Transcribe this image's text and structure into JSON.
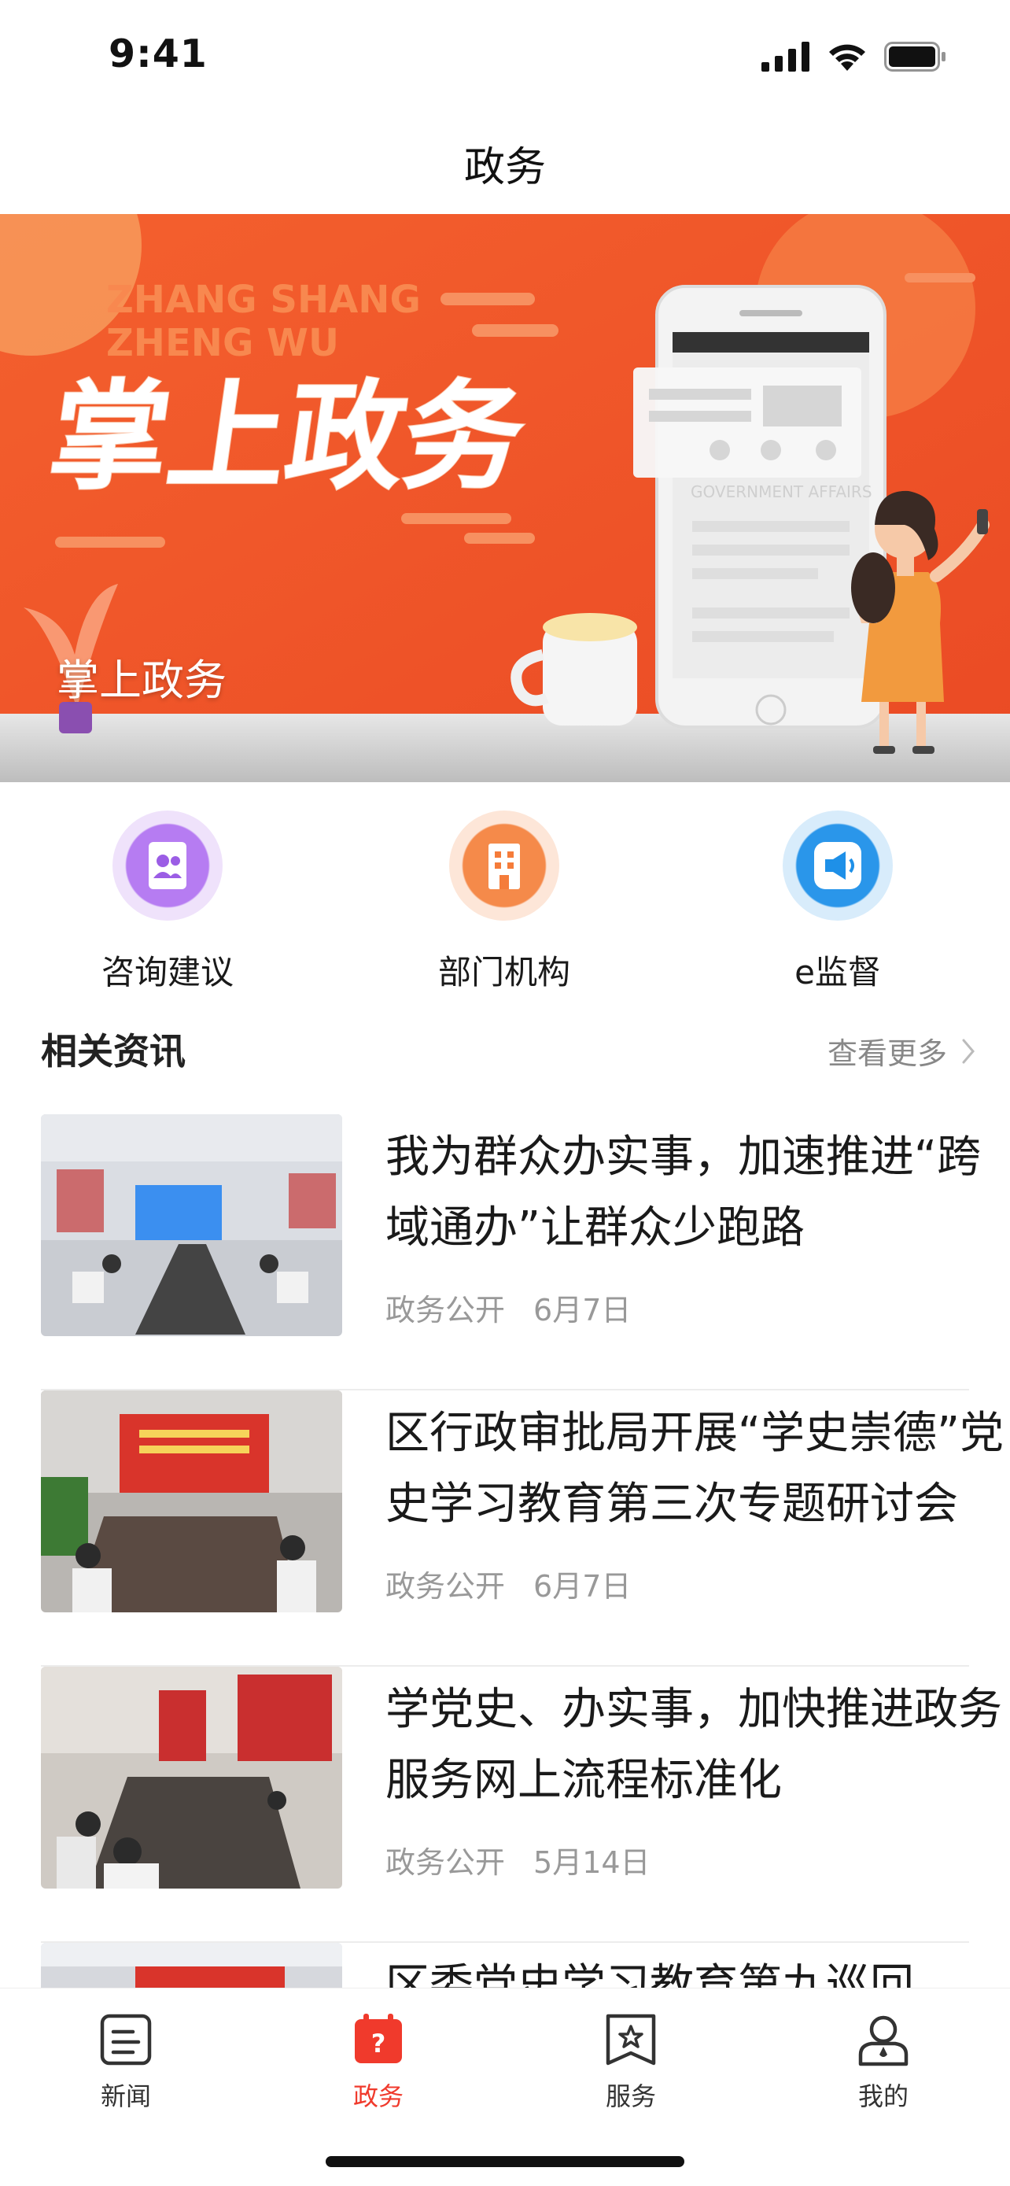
{
  "status": {
    "time": "9:41"
  },
  "nav": {
    "title": "政务"
  },
  "banner": {
    "pinyin_line1": "ZHANG SHANG",
    "pinyin_line2": "ZHENG WU",
    "headline": "掌上政务",
    "phone_text": "GOVERNMENT AFFAIRS",
    "caption": "掌上政务"
  },
  "quick_actions": [
    {
      "label": "咨询建议",
      "icon": "people-book-icon",
      "color": "#9b5de5"
    },
    {
      "label": "部门机构",
      "icon": "building-icon",
      "color": "#f57c3a"
    },
    {
      "label": "e监督",
      "icon": "megaphone-icon",
      "color": "#1e90e8"
    }
  ],
  "section": {
    "title": "相关资讯",
    "more": "查看更多"
  },
  "news": [
    {
      "title": "我为群众办实事，加速推进“跨域通办”让群众少跑路",
      "source": "政务公开",
      "date": "6月7日"
    },
    {
      "title": "区行政审批局开展“学史崇德”党史学习教育第三次专题研讨会",
      "source": "政务公开",
      "date": "6月7日"
    },
    {
      "title": "学党史、办实事，加快推进政务服务网上流程标准化",
      "source": "政务公开",
      "date": "5月14日"
    },
    {
      "title": "区委党史学习教育第九巡回",
      "source": "",
      "date": ""
    }
  ],
  "tabs": [
    {
      "label": "新闻",
      "icon": "news-icon",
      "active": false
    },
    {
      "label": "政务",
      "icon": "government-icon",
      "active": true
    },
    {
      "label": "服务",
      "icon": "service-icon",
      "active": false
    },
    {
      "label": "我的",
      "icon": "profile-icon",
      "active": false
    }
  ],
  "colors": {
    "accent": "#f03a2c",
    "banner": "#f2542b"
  }
}
